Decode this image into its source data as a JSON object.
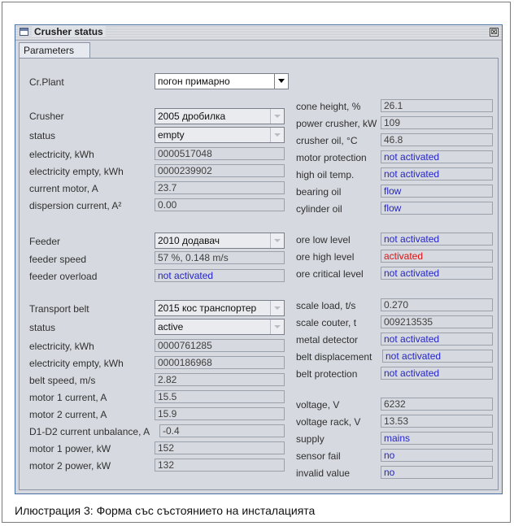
{
  "window": {
    "title": "Crusher status",
    "close_glyph": "⊠",
    "tab": "Parameters"
  },
  "plant": {
    "label": "Cr.Plant",
    "value": "погон примарно"
  },
  "crusher": {
    "label": "Crusher",
    "value": "2005 дробилка",
    "status_label": "status",
    "status_value": "empty",
    "electricity_label": "electricity, kWh",
    "electricity_value": "0000517048",
    "electricity_empty_label": "electricity empty, kWh",
    "electricity_empty_value": "0000239902",
    "current_motor_label": "current motor, A",
    "current_motor_value": "23.7",
    "dispersion_label": "dispersion current, A²",
    "dispersion_value": "0.00"
  },
  "crusher_right": {
    "cone_height_label": "cone height, %",
    "cone_height_value": "26.1",
    "power_label": "power crusher, kW",
    "power_value": "109",
    "oil_label": "crusher oil, °C",
    "oil_value": "46.8",
    "motor_protection_label": "motor protection",
    "motor_protection_value": "not activated",
    "high_oil_label": "high oil temp.",
    "high_oil_value": "not activated",
    "bearing_label": "bearing oil",
    "bearing_value": "flow",
    "cylinder_label": "cylinder oil",
    "cylinder_value": "flow"
  },
  "feeder": {
    "label": "Feeder",
    "value": "2010 додавач",
    "speed_label": "feeder speed",
    "speed_value": "57 %, 0.148 m/s",
    "overload_label": "feeder overload",
    "overload_value": "not activated"
  },
  "ore": {
    "low_label": "ore low level",
    "low_value": "not activated",
    "high_label": "ore high level",
    "high_value": "activated",
    "critical_label": "ore critical level",
    "critical_value": "not activated"
  },
  "belt": {
    "label": "Transport belt",
    "value": "2015 кос транспортер",
    "status_label": "status",
    "status_value": "active",
    "electricity_label": "electricity, kWh",
    "electricity_value": "0000761285",
    "electricity_empty_label": "electricity empty, kWh",
    "electricity_empty_value": "0000186968",
    "speed_label": "belt speed, m/s",
    "speed_value": "2.82",
    "motor1_current_label": "motor 1 current, A",
    "motor1_current_value": "15.5",
    "motor2_current_label": "motor 2 current, A",
    "motor2_current_value": "15.9",
    "unbalance_label": "D1-D2 current unbalance, A",
    "unbalance_value": "-0.4",
    "motor1_power_label": "motor 1 power, kW",
    "motor1_power_value": "152",
    "motor2_power_label": "motor 2 power, kW",
    "motor2_power_value": "132"
  },
  "scale": {
    "load_label": "scale load, t/s",
    "load_value": "0.270",
    "counter_label": "scale couter, t",
    "counter_value": "009213535",
    "metal_label": "metal detector",
    "metal_value": "not activated",
    "displacement_label": "belt displacement",
    "displacement_value": "not activated",
    "protection_label": "belt protection",
    "protection_value": "not activated"
  },
  "supply": {
    "voltage_label": "voltage, V",
    "voltage_value": "6232",
    "rack_label": "voltage rack, V",
    "rack_value": "13.53",
    "supply_label": "supply",
    "supply_value": "mains",
    "sensor_label": "sensor fail",
    "sensor_value": "no",
    "invalid_label": "invalid value",
    "invalid_value": "no"
  },
  "caption": "Илюстрация 3: Форма със състоянието на инсталацията",
  "colors": {
    "link_blue": "#2424c8",
    "alarm_red": "#e01010",
    "panel_bg": "#d6d9df"
  }
}
